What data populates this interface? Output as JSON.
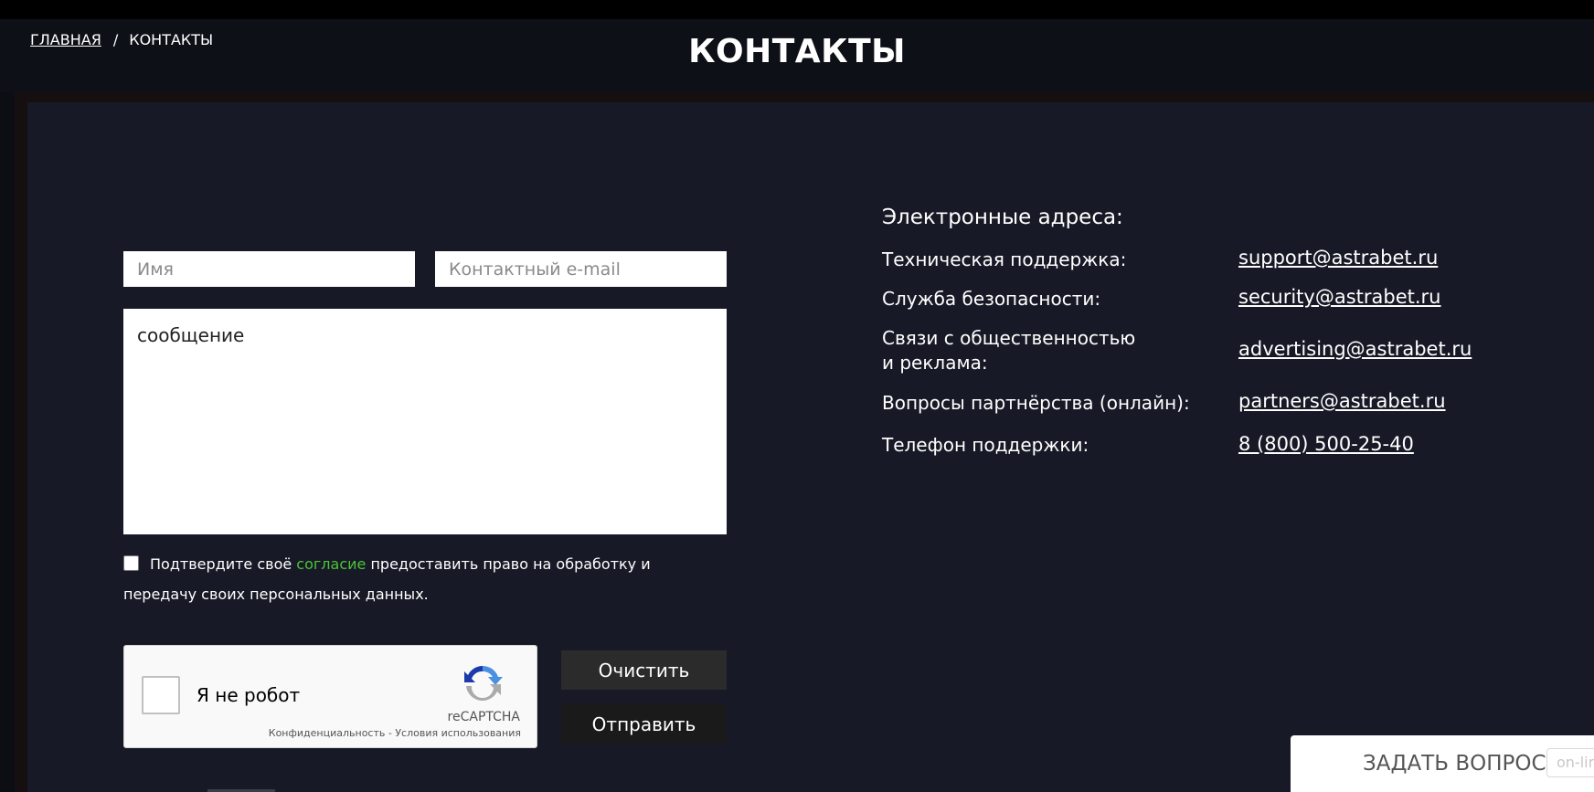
{
  "breadcrumb": {
    "home": "ГЛАВНАЯ",
    "separator": "/",
    "current": "КОНТАКТЫ"
  },
  "page": {
    "title": "КОНТАКТЫ"
  },
  "form": {
    "name_placeholder": "Имя",
    "email_placeholder": "Контактный e-mail",
    "message_value": "сообщение",
    "consent": {
      "checked": false,
      "text_before": "Подтвердите своё ",
      "link": "согласие",
      "text_after": " предоставить право на обработку и передачу своих персональных данных."
    },
    "clear_label": "Очистить",
    "send_label": "Отправить"
  },
  "recaptcha": {
    "label": "Я не робот",
    "brand": "reCAPTCHA",
    "privacy": "Конфиденциальность",
    "links_separator": " - ",
    "terms": "Условия использования"
  },
  "contacts": {
    "title": "Электронные адреса:",
    "items": [
      {
        "label": "Техническая поддержка:",
        "value": "support@astrabet.ru"
      },
      {
        "label": "Служба безопасности:",
        "value": "security@astrabet.ru"
      },
      {
        "label_line1": "Связи с общественностью",
        "label_line2": "и реклама:",
        "value": "advertising@astrabet.ru"
      },
      {
        "label": "Вопросы партнёрства (онлайн):",
        "value": "partners@astrabet.ru"
      },
      {
        "label": "Телефон поддержки:",
        "value": "8 (800) 500-25-40"
      }
    ]
  },
  "widget": {
    "label": "ЗАДАТЬ ВОПРОС",
    "badge": "on-line"
  },
  "colors": {
    "accent_green": "#4cc337",
    "panel": "#171a26",
    "background": "#0c0e14"
  }
}
